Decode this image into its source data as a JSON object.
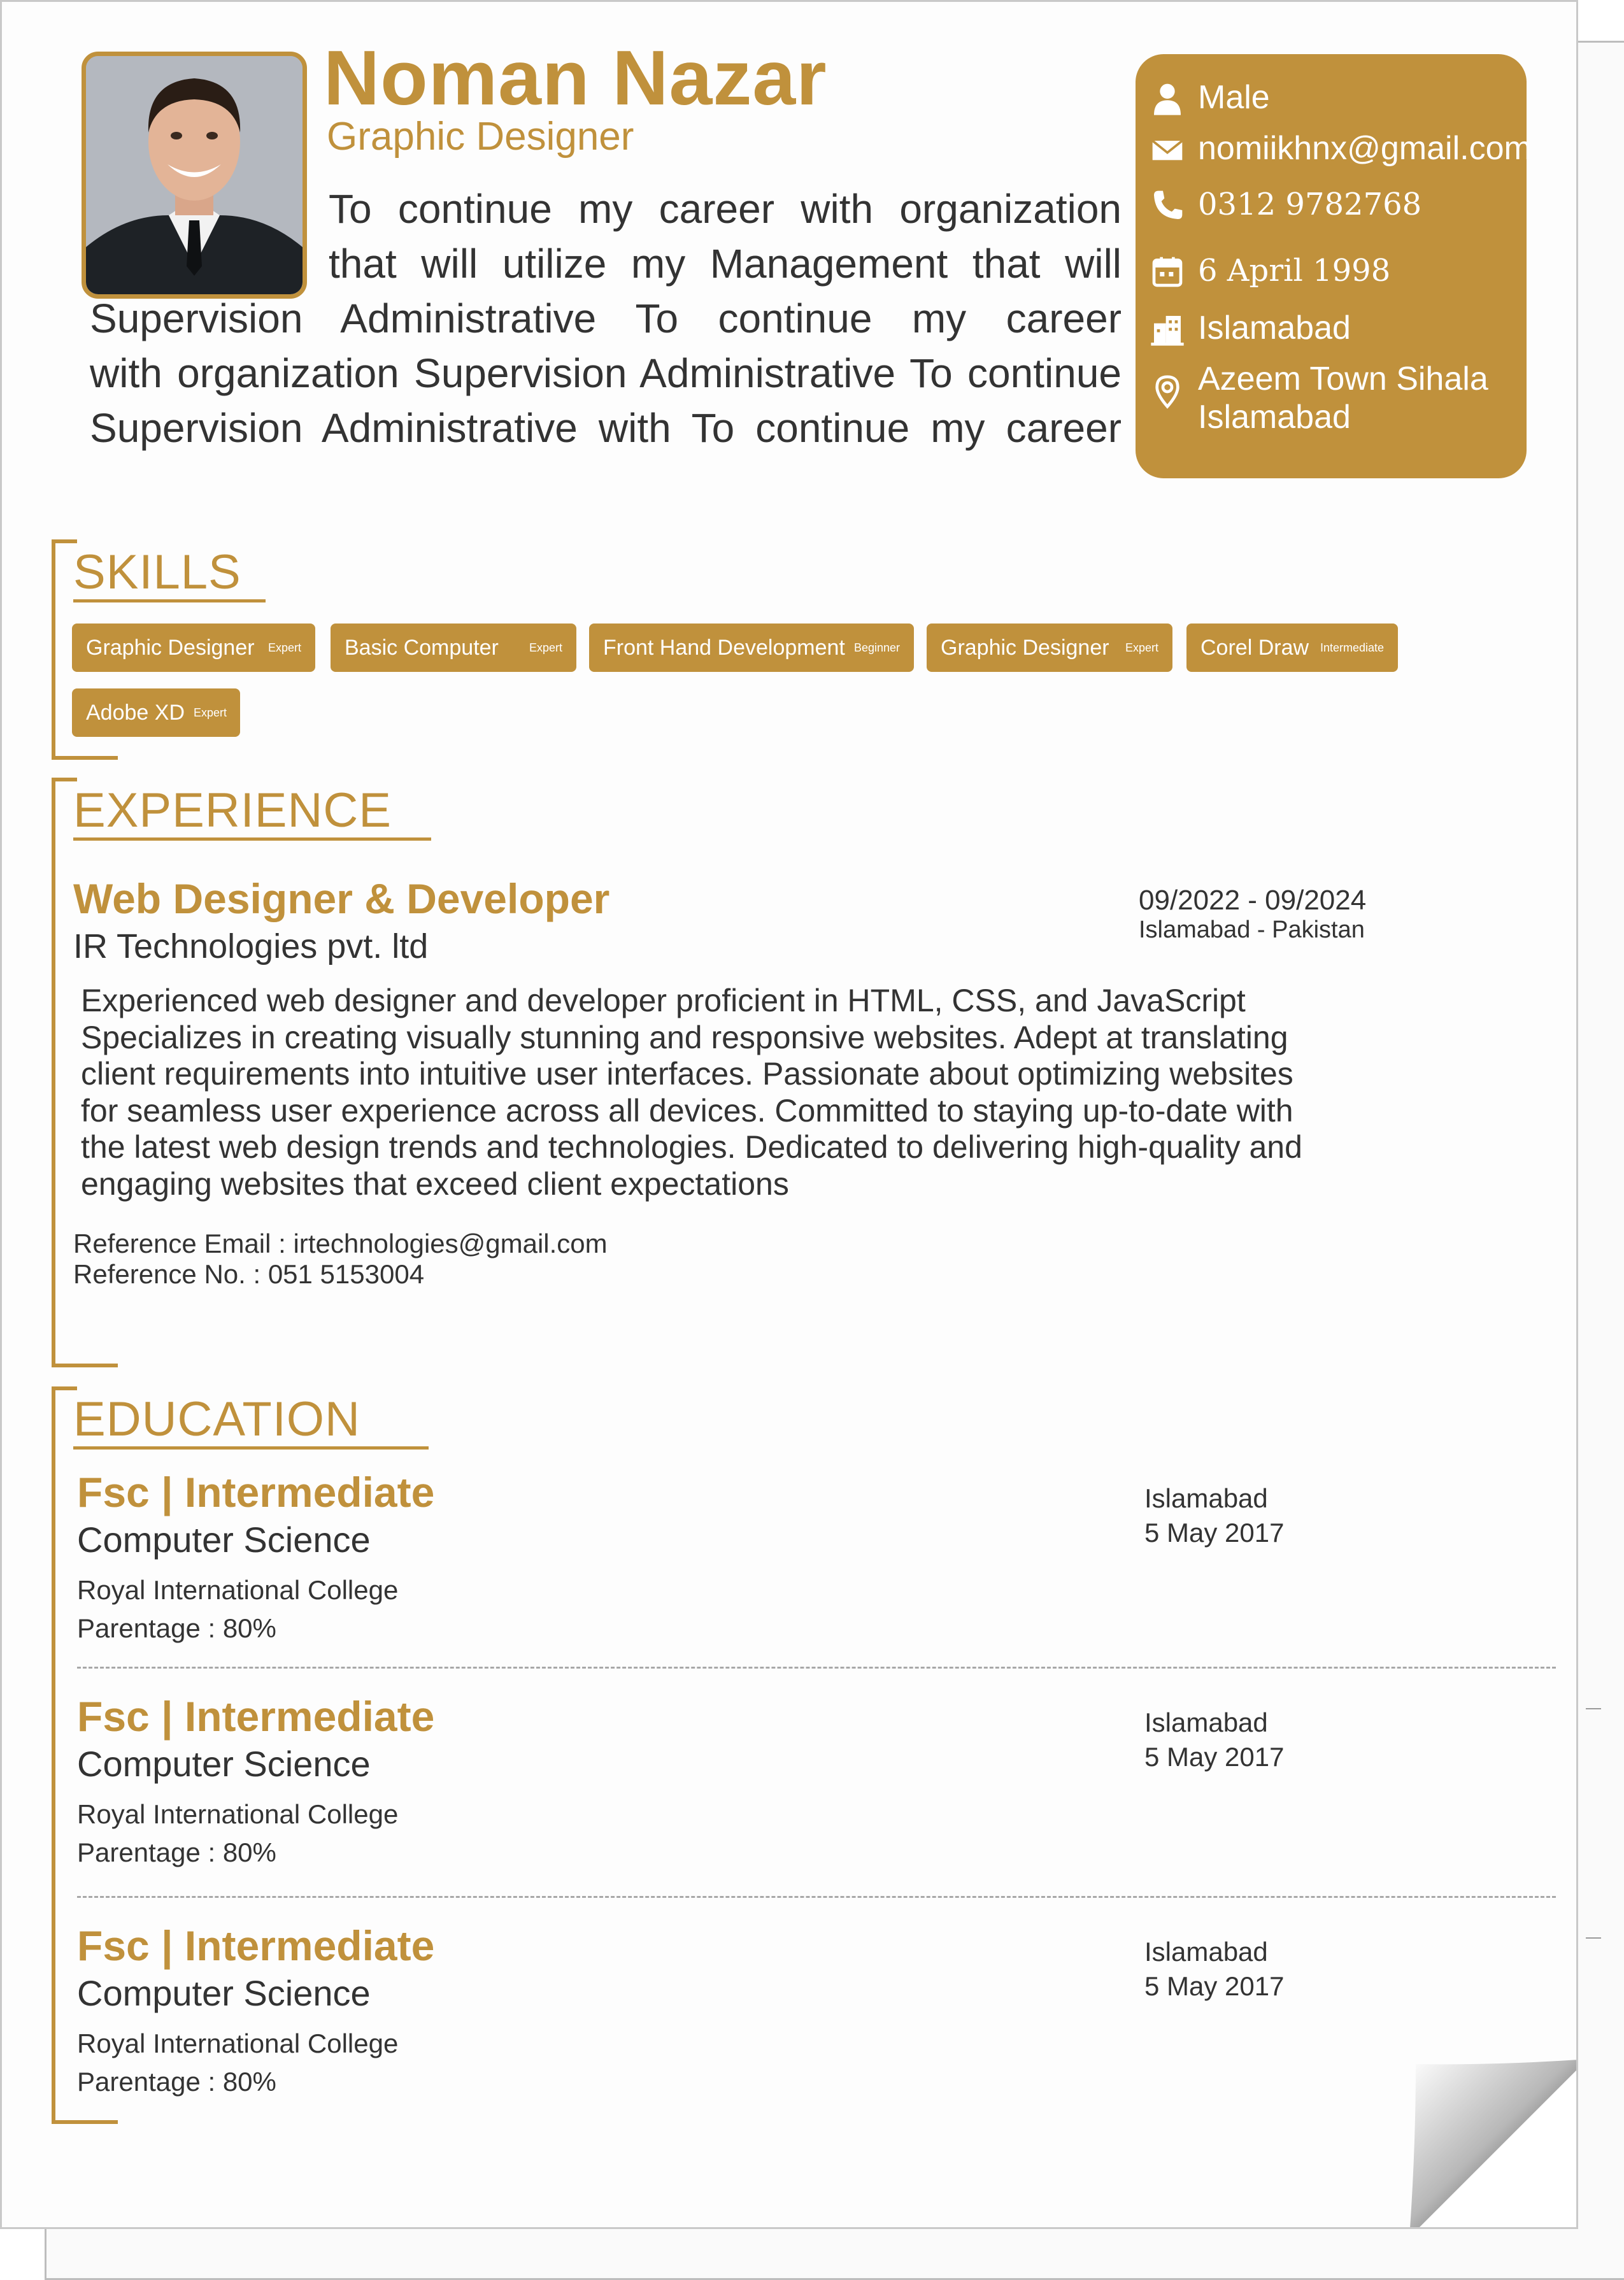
{
  "header": {
    "name": "Noman Nazar",
    "role": "Graphic Designer",
    "summary_lines": [
      "To  continue  my  career  with  organization",
      "that  will  utilize  my  Management  that  will",
      "Supervision  Administrative  To continue  my  career",
      "with organization  Supervision Administrative To continue",
      "Supervision Administrative with  To  continue  my career"
    ]
  },
  "contact": {
    "gender": "Male",
    "email": "nomiikhnx@gmail.com",
    "phone": "0312 9782768",
    "dob": "6 April 1998",
    "city": "Islamabad",
    "address_line1": "Azeem Town Sihala",
    "address_line2": "Islamabad",
    "icons": [
      "user-icon",
      "mail-icon",
      "phone-icon",
      "calendar-icon",
      "building-icon",
      "location-pin-icon"
    ]
  },
  "skills": {
    "title": "SKILLS",
    "items": [
      {
        "name": "Graphic Designer",
        "level": "Expert"
      },
      {
        "name": "Basic Computer",
        "level": "Expert"
      },
      {
        "name": "Front Hand Development",
        "level": "Beginner"
      },
      {
        "name": "Graphic Designer",
        "level": "Expert"
      },
      {
        "name": "Corel Draw",
        "level": "Intermediate"
      },
      {
        "name": "Adobe XD",
        "level": "Expert"
      }
    ]
  },
  "experience": {
    "title": "EXPERIENCE",
    "job_title": "Web Designer & Developer",
    "company": "IR Technologies pvt. ltd",
    "dates": "09/2022 - 09/2024",
    "location": "Islamabad - Pakistan",
    "description_lines": [
      "Experienced web designer and developer proficient in  HTML, CSS, and JavaScript",
      "Specializes in creating  visually stunning and responsive websites. Adept at translating",
      "client requirements into intuitive user interfaces. Passionate about optimizing websites",
      "for seamless user experience across all devices. Committed to staying up-to-date with",
      "the latest web design trends and technologies. Dedicated to delivering high-quality and",
      "engaging websites that exceed client expectations"
    ],
    "reference_email": "Reference Email : irtechnologies@gmail.com",
    "reference_no": "Reference No. : 051 5153004"
  },
  "education": {
    "title": "EDUCATION",
    "items": [
      {
        "title": "Fsc | Intermediate",
        "field": "Computer Science",
        "school": "Royal International College",
        "percentage": "Parentage : 80%",
        "city": "Islamabad",
        "date": "5 May 2017"
      },
      {
        "title": "Fsc | Intermediate",
        "field": "Computer Science",
        "school": "Royal International College",
        "percentage": "Parentage : 80%",
        "city": "Islamabad",
        "date": "5 May 2017"
      },
      {
        "title": "Fsc | Intermediate",
        "field": "Computer Science",
        "school": "Royal International College",
        "percentage": "Parentage : 80%",
        "city": "Islamabad",
        "date": "5 May 2017"
      }
    ]
  },
  "colors": {
    "accent": "#c0913c",
    "text": "#333333",
    "page": "#fdfdfd"
  }
}
